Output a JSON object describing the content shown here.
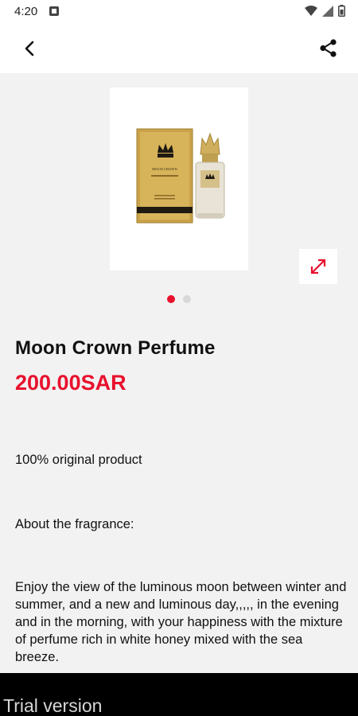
{
  "status_bar": {
    "time": "4:20",
    "icons": [
      "notification-icon",
      "wifi-icon",
      "signal-icon",
      "battery-icon"
    ]
  },
  "app_bar": {
    "back_icon": "back-arrow-icon",
    "share_icon": "share-icon"
  },
  "gallery": {
    "image_description": "Moon Crown perfume bottle with gold box",
    "box_text": "MOON CROWN",
    "expand_icon": "expand-icon",
    "pages": 2,
    "active_page": 1
  },
  "product": {
    "title": "Moon Crown Perfume",
    "price": "200.00SAR",
    "description": [
      "100% original product",
      "About the fragrance:",
      "Enjoy the view of the luminous moon between winter and summer, and a new and luminous day,,,,, in the evening and in the morning, with your happiness with the mixture of perfume rich in white honey mixed with the sea breeze."
    ]
  },
  "watermark": {
    "text": "Trial version"
  },
  "colors": {
    "accent": "#e8112d",
    "background": "#f2f2f2",
    "bar": "#ffffff",
    "trial_bar": "#000000"
  }
}
